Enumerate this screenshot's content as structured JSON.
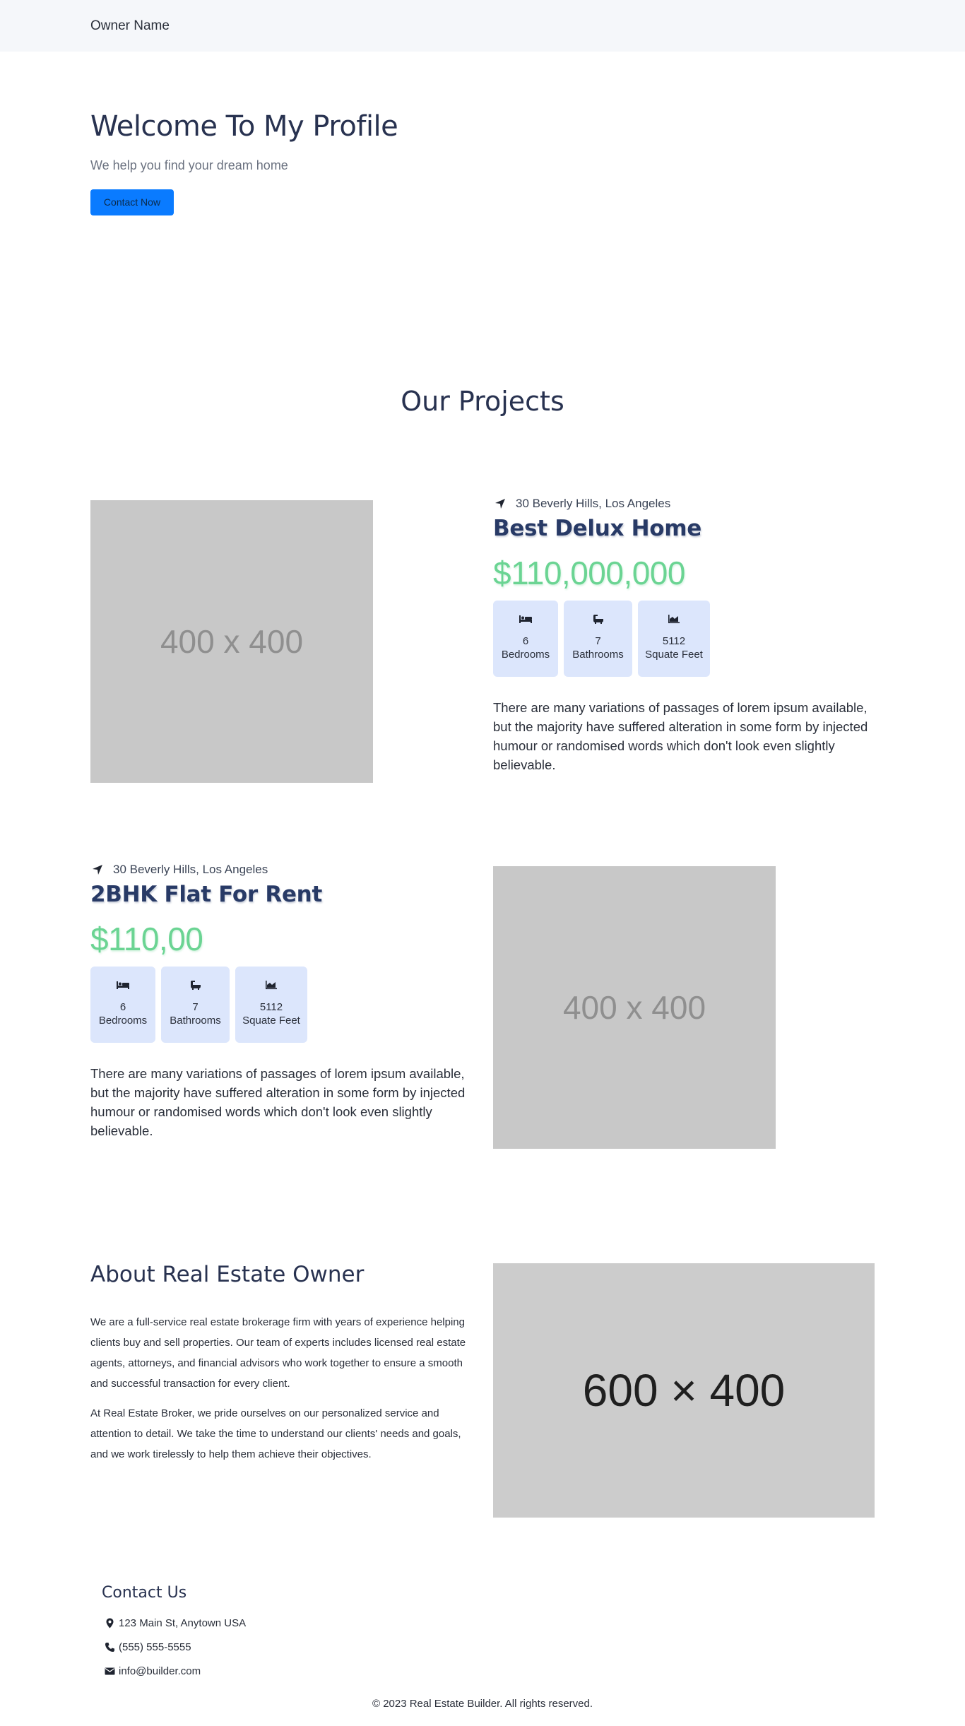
{
  "navbar": {
    "brand": "Owner Name"
  },
  "hero": {
    "title": "Welcome To My Profile",
    "subtitle": "We help you find your dream home",
    "cta_label": "Contact Now"
  },
  "projects_section": {
    "title": "Our Projects"
  },
  "projects": [
    {
      "image_label": "400 x 400",
      "location": "30 Beverly Hills, Los Angeles",
      "title": "Best Delux Home",
      "price": "$110,000,000",
      "features": [
        {
          "icon": "bed-icon",
          "value": "6",
          "label": "Bedrooms"
        },
        {
          "icon": "bath-icon",
          "value": "7",
          "label": "Bathrooms"
        },
        {
          "icon": "area-chart-icon",
          "value": "5112",
          "label": "Squate Feet"
        }
      ],
      "description": "There are many variations of passages of lorem ipsum available, but the majority have suffered alteration in some form by injected humour or randomised words which don't look even slightly believable."
    },
    {
      "image_label": "400 x 400",
      "location": "30 Beverly Hills, Los Angeles",
      "title": "2BHK Flat For Rent",
      "price": "$110,00",
      "features": [
        {
          "icon": "bed-icon",
          "value": "6",
          "label": "Bedrooms"
        },
        {
          "icon": "bath-icon",
          "value": "7",
          "label": "Bathrooms"
        },
        {
          "icon": "area-chart-icon",
          "value": "5112",
          "label": "Squate Feet"
        }
      ],
      "description": "There are many variations of passages of lorem ipsum available, but the majority have suffered alteration in some form by injected humour or randomised words which don't look even slightly believable."
    }
  ],
  "about": {
    "title": "About Real Estate Owner",
    "paragraphs": [
      "We are a full-service real estate brokerage firm with years of experience helping clients buy and sell properties. Our team of experts includes licensed real estate agents, attorneys, and financial advisors who work together to ensure a smooth and successful transaction for every client.",
      "At Real Estate Broker, we pride ourselves on our personalized service and attention to detail. We take the time to understand our clients' needs and goals, and we work tirelessly to help them achieve their objectives."
    ],
    "image_label": "600 × 400"
  },
  "contact": {
    "title": "Contact Us",
    "address": "123 Main St, Anytown USA",
    "phone": "(555) 555-5555",
    "email": "info@builder.com"
  },
  "footer": {
    "copyright": "© 2023 Real Estate Builder. All rights reserved."
  },
  "colors": {
    "accent": "#0a7bff",
    "heading": "#283250",
    "price": "#6bd493",
    "feature_bg": "#dce6fc",
    "placeholder": "#c8c8c8"
  }
}
